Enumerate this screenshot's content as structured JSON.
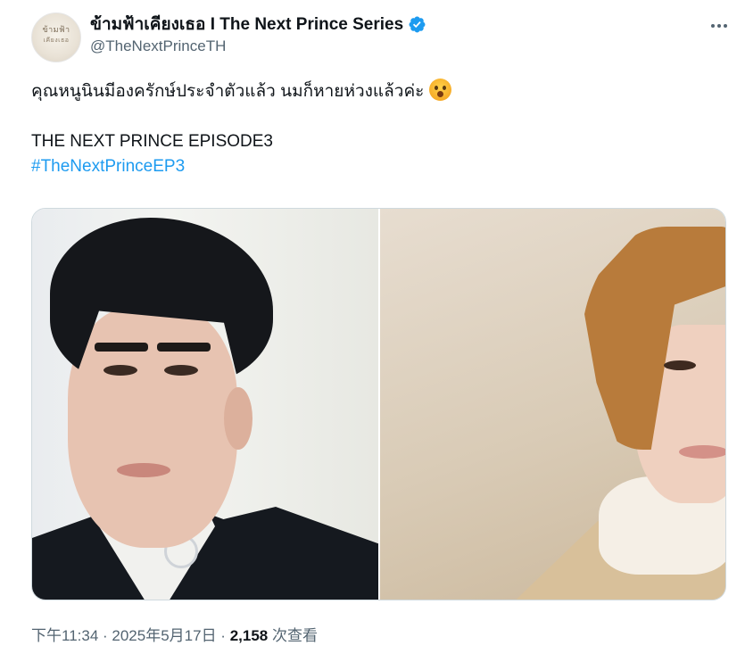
{
  "author": {
    "display_name": "ข้ามฟ้าเคียงเธอ I The Next Prince Series",
    "handle": "@TheNextPrinceTH",
    "avatar_logo_line1": "ข้ามฟ้า",
    "avatar_logo_line2": "เคียงเธอ",
    "verified_icon": "verified-badge-icon",
    "verified_color": "#1d9bf0"
  },
  "tweet": {
    "line1": "คุณหนูนินมีองครักษ์ประจำตัวแล้ว นมก็หายห่วงแล้วค่ะ",
    "emoji": "face-with-open-mouth-emoji",
    "line2": "THE NEXT PRINCE EPISODE3",
    "hashtag": "#TheNextPrinceEP3",
    "hashtag_color": "#1d9bf0"
  },
  "meta": {
    "time": "下午11:34",
    "separator": " · ",
    "date": "2025年5月17日",
    "views_count": "2,158",
    "views_label": " 次查看"
  }
}
